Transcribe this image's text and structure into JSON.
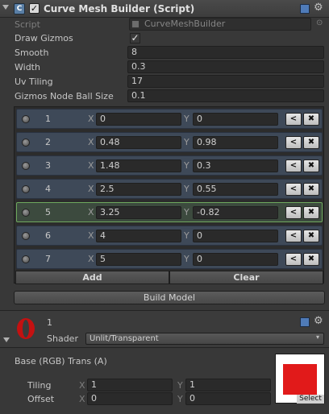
{
  "component": {
    "title": "Curve Mesh Builder (Script)",
    "enabled": true,
    "script_label": "Script",
    "script_value": "CurveMeshBuilder"
  },
  "props": {
    "draw_gizmos_label": "Draw Gizmos",
    "draw_gizmos": true,
    "smooth_label": "Smooth",
    "smooth": "8",
    "width_label": "Width",
    "width": "0.3",
    "uv_tiling_label": "Uv Tiling",
    "uv_tiling": "17",
    "gizmo_ball_label": "Gizmos Node Ball Size",
    "gizmo_ball": "0.1"
  },
  "nodes": [
    {
      "index": "1",
      "x": "0",
      "y": "0",
      "selected": false
    },
    {
      "index": "2",
      "x": "0.48",
      "y": "0.98",
      "selected": false
    },
    {
      "index": "3",
      "x": "1.48",
      "y": "0.3",
      "selected": false
    },
    {
      "index": "4",
      "x": "2.5",
      "y": "0.55",
      "selected": false
    },
    {
      "index": "5",
      "x": "3.25",
      "y": "-0.82",
      "selected": true
    },
    {
      "index": "6",
      "x": "4",
      "y": "0",
      "selected": false
    },
    {
      "index": "7",
      "x": "5",
      "y": "0",
      "selected": false
    }
  ],
  "labels": {
    "x": "X",
    "y": "Y",
    "insert_glyph": "<",
    "remove_glyph": "✖",
    "add": "Add",
    "clear": "Clear",
    "build": "Build Model"
  },
  "material": {
    "name": "1",
    "shader_label": "Shader",
    "shader_value": "Unlit/Transparent",
    "base_label": "Base (RGB) Trans (A)",
    "tiling_label": "Tiling",
    "tiling_x": "1",
    "tiling_y": "1",
    "offset_label": "Offset",
    "offset_x": "0",
    "offset_y": "0",
    "texture_color": "#e11a1a",
    "select_label": "Select"
  },
  "icons": {
    "script": "script-icon",
    "help": "help-book-icon",
    "settings": "gear-icon",
    "material": "material-sphere-icon"
  }
}
